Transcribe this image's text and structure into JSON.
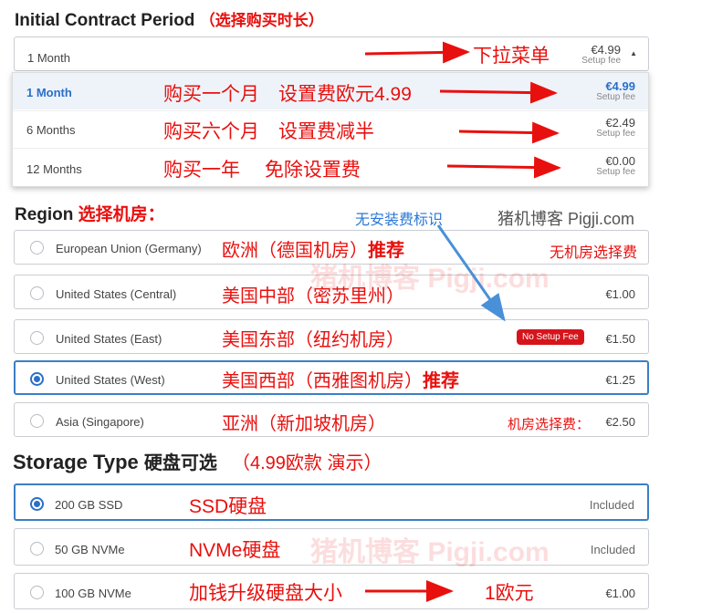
{
  "contract": {
    "title": "Initial Contract Period",
    "title_note": "（选择购买时长）",
    "selected": {
      "label": "1 Month",
      "price": "€4.99",
      "fee_label": "Setup fee"
    },
    "dropdown_note": "下拉菜单",
    "options": [
      {
        "label": "1 Month",
        "price": "€4.99",
        "fee_label": "Setup fee",
        "note": "购买一个月　设置费欧元4.99",
        "active": true
      },
      {
        "label": "6 Months",
        "price": "€2.49",
        "fee_label": "Setup fee",
        "note": "购买六个月　设置费减半",
        "active": false
      },
      {
        "label": "12 Months",
        "price": "€0.00",
        "fee_label": "Setup fee",
        "note": "购买一年　 免除设置费",
        "active": false
      }
    ]
  },
  "region": {
    "title": "Region",
    "title_note": "选择机房：",
    "no_fee_note": "无安装费标识",
    "site_label": "猪机博客 Pigji.com",
    "watermark": "猪机博客 Pigji.com",
    "items": [
      {
        "label": "European Union (Germany)",
        "note": "欧洲（德国机房）",
        "note_bold": "推荐",
        "price": "",
        "extra": "无机房选择费",
        "selected": false
      },
      {
        "label": "United States (Central)",
        "note": "美国中部（密苏里州）",
        "note_bold": "",
        "price": "€1.00",
        "extra": "",
        "selected": false
      },
      {
        "label": "United States (East)",
        "note": "美国东部（纽约机房）",
        "note_bold": "",
        "price": "€1.50",
        "badge": "No Setup Fee",
        "extra": "",
        "selected": false
      },
      {
        "label": "United States (West)",
        "note": "美国西部（西雅图机房）",
        "note_bold": "推荐",
        "price": "€1.25",
        "extra": "",
        "selected": true
      },
      {
        "label": "Asia (Singapore)",
        "note": "亚洲（新加坡机房）",
        "note_bold": "",
        "price": "€2.50",
        "extra": "机房选择费：",
        "selected": false
      }
    ]
  },
  "storage": {
    "title": "Storage Type",
    "title_cn": "硬盘可选",
    "title_note": "（4.99欧款 演示）",
    "watermark": "猪机博客 Pigji.com",
    "items": [
      {
        "label": "200 GB SSD",
        "note": "SSD硬盘",
        "price": "Included",
        "selected": true
      },
      {
        "label": "50 GB NVMe",
        "note": "NVMe硬盘",
        "price": "Included",
        "selected": false
      },
      {
        "label": "100 GB NVMe",
        "note": "加钱升级硬盘大小",
        "note2": "1欧元",
        "price": "€1.00",
        "selected": false
      }
    ]
  },
  "colors": {
    "annotation": "#e8100e",
    "accent": "#3b7fc4",
    "badge": "#d6141b",
    "arrow_blue": "#4a90d9"
  }
}
